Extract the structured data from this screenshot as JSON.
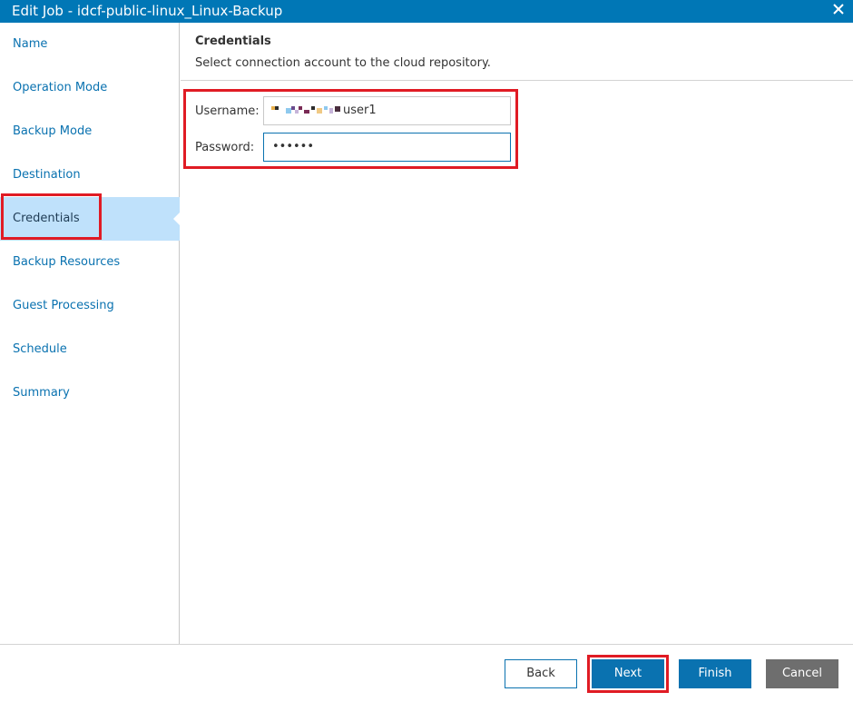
{
  "window": {
    "title": "Edit Job - idcf-public-linux_Linux-Backup",
    "close_icon": "close-icon"
  },
  "sidebar": {
    "items": [
      {
        "label": "Name",
        "active": false
      },
      {
        "label": "Operation Mode",
        "active": false
      },
      {
        "label": "Backup Mode",
        "active": false
      },
      {
        "label": "Destination",
        "active": false
      },
      {
        "label": "Credentials",
        "active": true
      },
      {
        "label": "Backup Resources",
        "active": false
      },
      {
        "label": "Guest Processing",
        "active": false
      },
      {
        "label": "Schedule",
        "active": false
      },
      {
        "label": "Summary",
        "active": false
      }
    ]
  },
  "credentials": {
    "heading": "Credentials",
    "description": "Select connection account to the cloud repository.",
    "username_label": "Username:",
    "username_value": "user1",
    "password_label": "Password:",
    "password_value": "••••••"
  },
  "footer": {
    "back_label": "Back",
    "next_label": "Next",
    "finish_label": "Finish",
    "cancel_label": "Cancel"
  },
  "colors": {
    "titlebar": "#0077b6",
    "accent": "#0a72b0",
    "active_nav": "#bfe1fb",
    "highlight": "#e01b24",
    "cancel": "#6e6e6e"
  }
}
